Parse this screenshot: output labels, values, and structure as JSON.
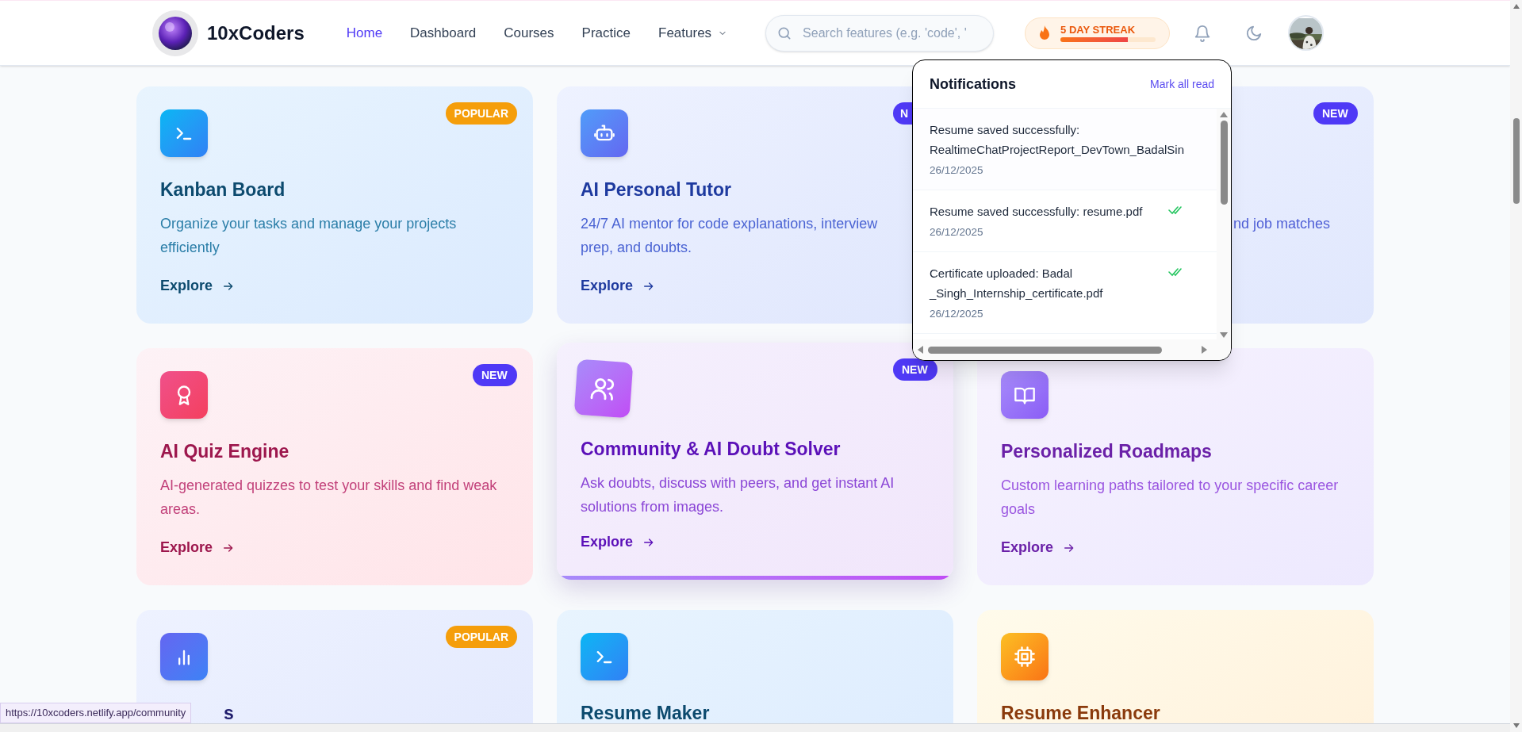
{
  "header": {
    "brand": "10xCoders",
    "nav": [
      {
        "label": "Home",
        "selected": true
      },
      {
        "label": "Dashboard",
        "selected": false
      },
      {
        "label": "Courses",
        "selected": false
      },
      {
        "label": "Practice",
        "selected": false
      },
      {
        "label": "Features",
        "selected": false,
        "dropdown": true
      }
    ],
    "search": {
      "placeholder": "Search features (e.g. 'code', '"
    },
    "streak": {
      "label": "5 DAY STREAK",
      "level": 0.71
    }
  },
  "cards": [
    {
      "badge": {
        "label": "POPULAR",
        "kind": "popular"
      },
      "title": "Kanban Board",
      "description": "Organize your tasks and manage your projects efficiently",
      "link": "Explore",
      "highlighted": false
    },
    {
      "badge": {
        "label": "N",
        "kind": "new"
      },
      "title": "AI Personal Tutor",
      "description": "24/7 AI mentor for code explanations, interview prep, and doubts.",
      "link": "Explore",
      "highlighted": false
    },
    {
      "badge": {
        "label": "NEW",
        "kind": "new"
      },
      "description": "nd job matches",
      "highlighted": false
    },
    {
      "badge": {
        "label": "NEW",
        "kind": "new"
      },
      "title": "AI Quiz Engine",
      "description": "AI-generated quizzes to test your skills and find weak areas.",
      "link": "Explore",
      "highlighted": false
    },
    {
      "badge": {
        "label": "NEW",
        "kind": "new"
      },
      "title": "Community & AI Doubt Solver",
      "description": "Ask doubts, discuss with peers, and get instant AI solutions from images.",
      "link": "Explore",
      "highlighted": true
    },
    {
      "title": "Personalized Roadmaps",
      "description": "Custom learning paths tailored to your specific career goals",
      "link": "Explore",
      "highlighted": false
    },
    {
      "badge": {
        "label": "POPULAR",
        "kind": "popular"
      },
      "title": "s",
      "highlighted": false
    },
    {
      "title": "Resume Maker",
      "highlighted": false
    },
    {
      "title": "Resume Enhancer",
      "highlighted": false
    }
  ],
  "notifications": {
    "title": "Notifications",
    "action": "Mark all read",
    "items": [
      {
        "text": "Resume saved successfully: RealtimeChatProjectReport_DevTown_BadalSin",
        "date": "26/12/2025"
      },
      {
        "text": "Resume saved successfully: resume.pdf",
        "date": "26/12/2025",
        "read": true
      },
      {
        "text": "Certificate uploaded: Badal _Singh_Internship_certificate.pdf",
        "date": "26/12/2025",
        "read": true
      }
    ]
  },
  "status_url": "https://10xcoders.netlify.app/community"
}
